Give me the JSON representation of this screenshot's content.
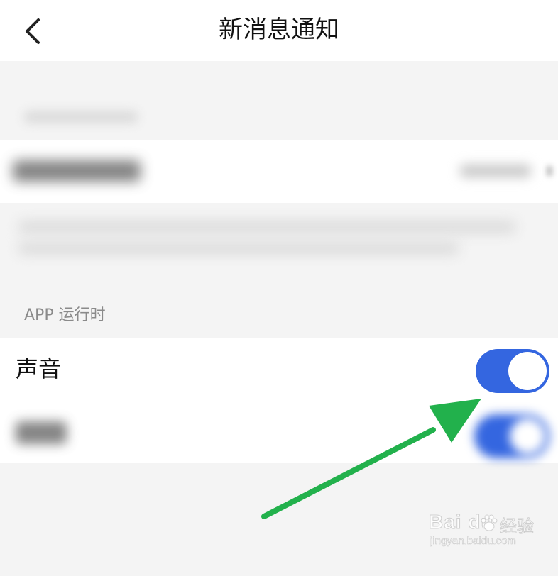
{
  "header": {
    "title": "新消息通知",
    "back_icon": "chevron-left-icon"
  },
  "section": {
    "label": "APP 运行时"
  },
  "rows": [
    {
      "label": "声音",
      "toggle": true
    }
  ],
  "watermark": {
    "brand": "Bai du",
    "brand_cn": "经验",
    "url": "jingyan.baidu.com"
  },
  "colors": {
    "accent": "#3466e0",
    "annotation_arrow": "#22b14c",
    "background": "#f4f4f4"
  }
}
